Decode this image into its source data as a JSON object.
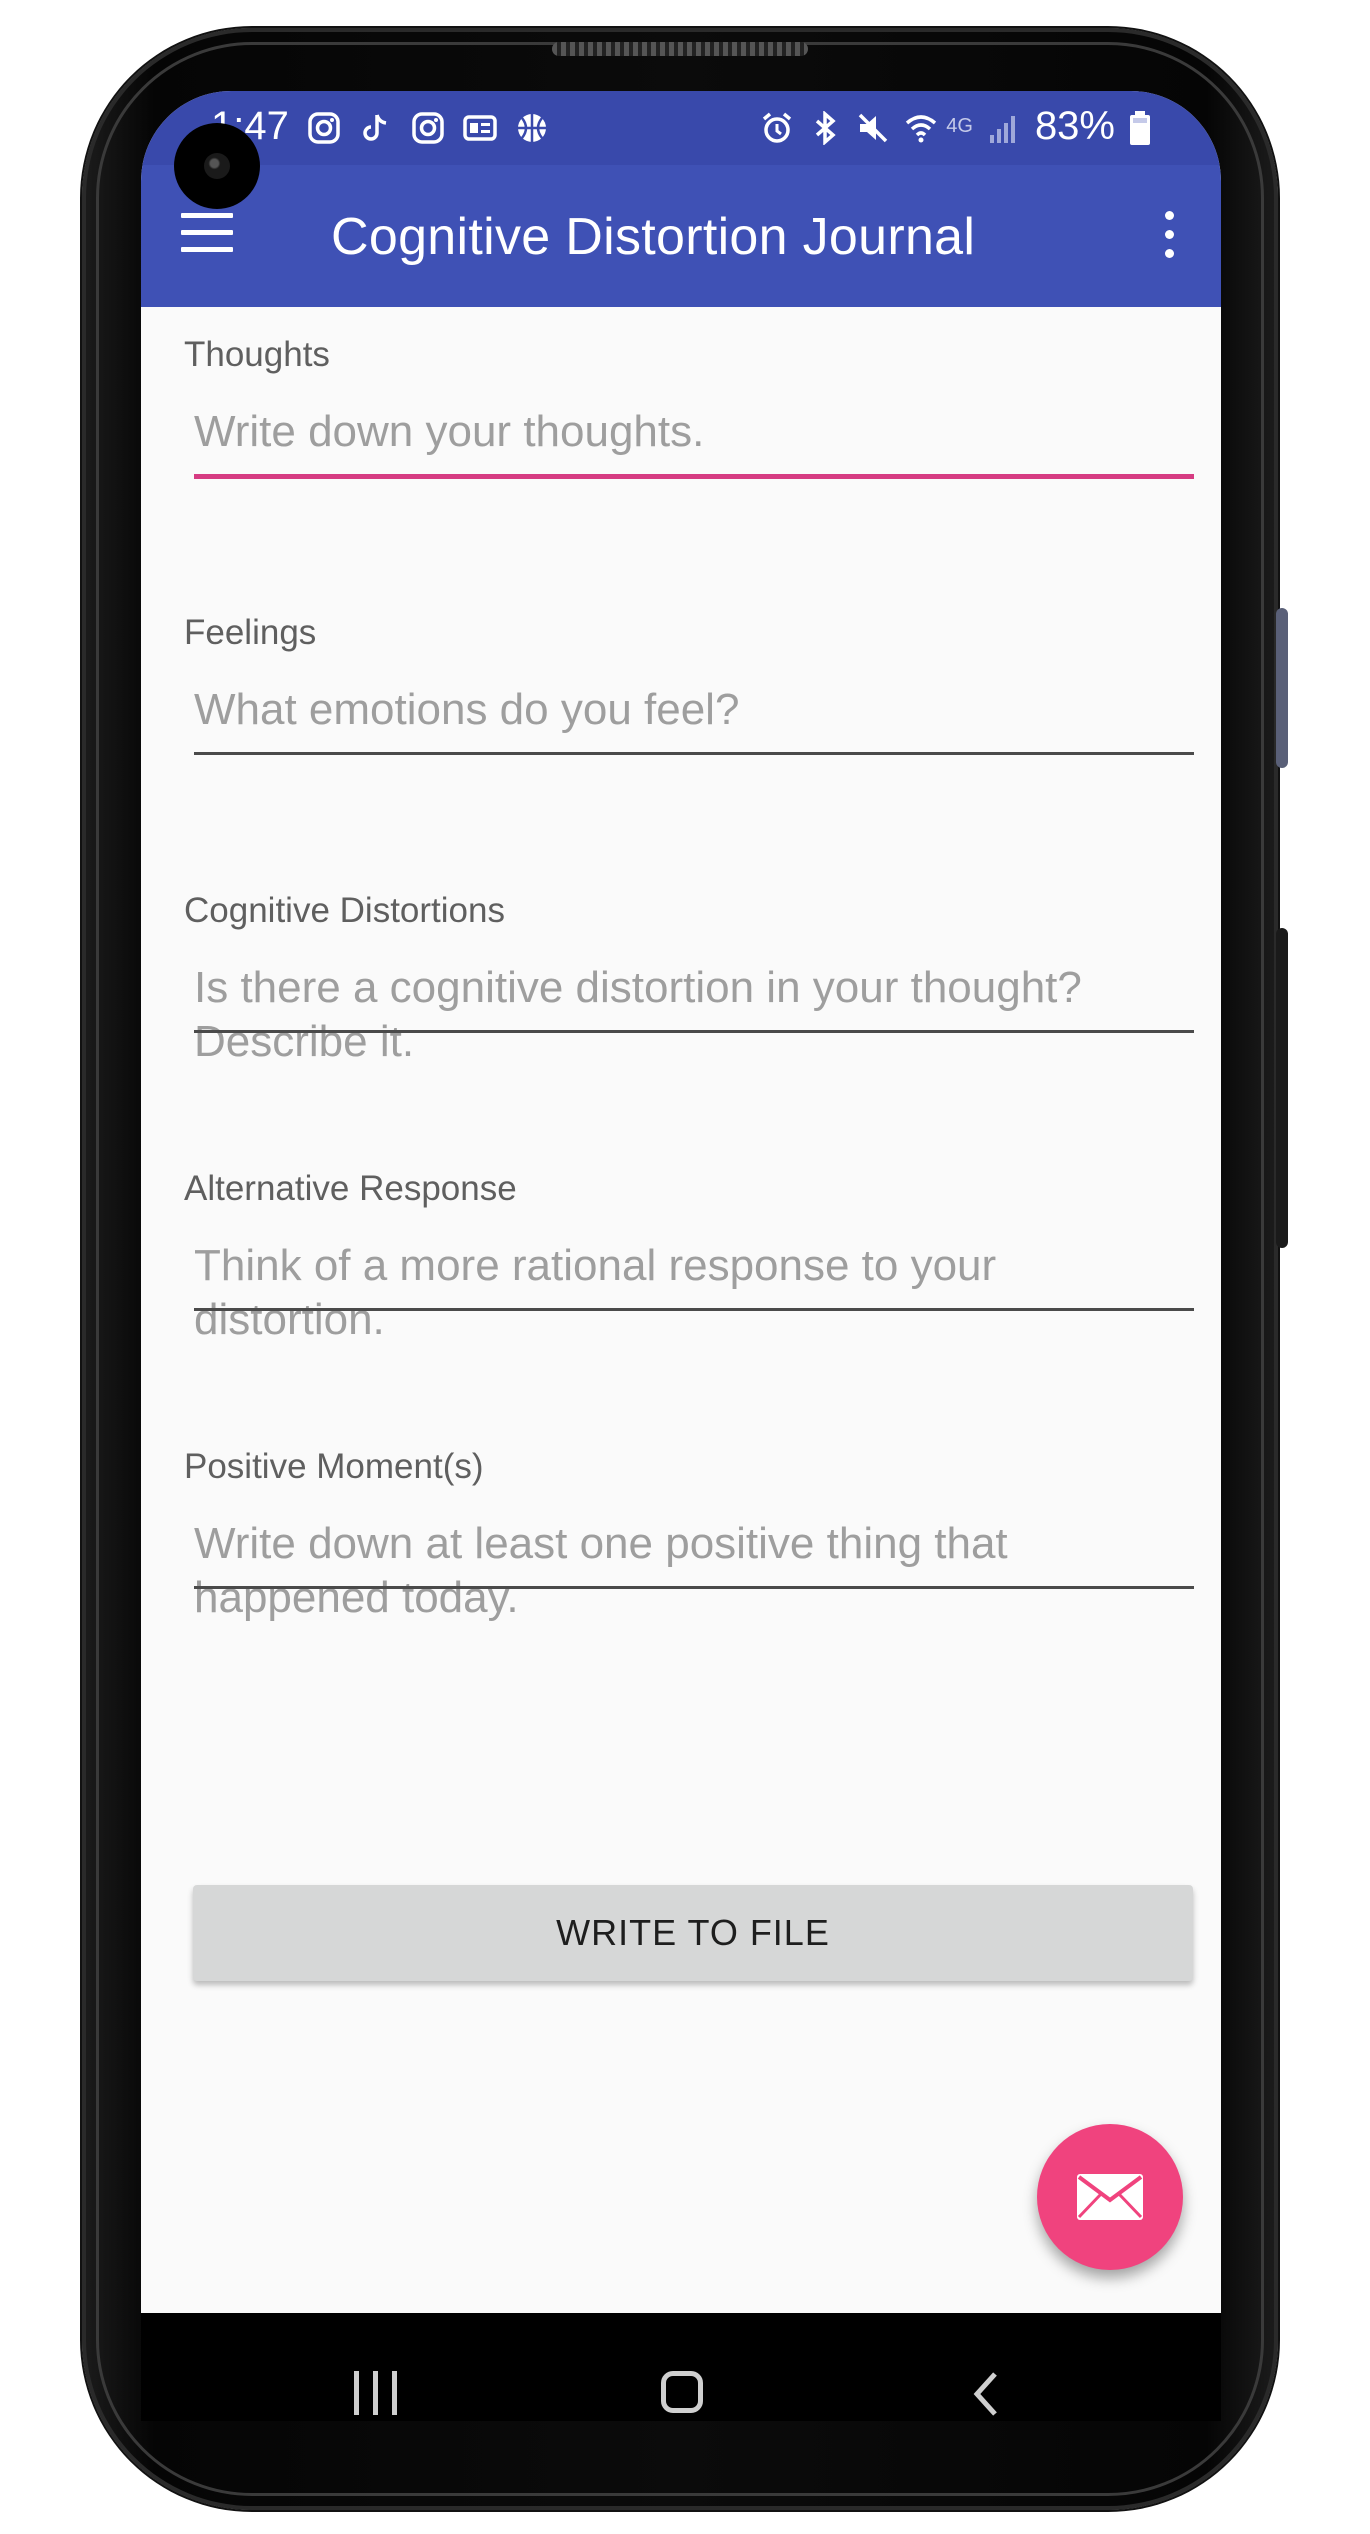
{
  "status_bar": {
    "time": "1:47",
    "notification_icons": [
      "instagram-icon",
      "tiktok-icon",
      "instagram-icon",
      "news-icon",
      "basketball-icon"
    ],
    "system_icons": [
      "alarm-icon",
      "bluetooth-icon",
      "mute-icon",
      "wifi-icon",
      "signal-icon"
    ],
    "network_label": "4G",
    "battery_percent": "83%"
  },
  "app_bar": {
    "title": "Cognitive Distortion Journal",
    "menu_icon": "hamburger-menu-icon",
    "overflow_icon": "more-vert-icon"
  },
  "form": {
    "fields": [
      {
        "label": "Thoughts",
        "placeholder": "Write down your thoughts.",
        "focused": true
      },
      {
        "label": "Feelings",
        "placeholder": "What emotions do you feel?",
        "focused": false
      },
      {
        "label": "Cognitive Distortions",
        "placeholder": "Is there a cognitive distortion in your thought? Describe it.",
        "focused": false
      },
      {
        "label": "Alternative Response",
        "placeholder": "Think of a more rational response to your distortion.",
        "focused": false
      },
      {
        "label": "Positive Moment(s)",
        "placeholder": "Write down at least one positive thing that happened today.",
        "focused": false
      }
    ],
    "submit_label": "WRITE TO FILE"
  },
  "fab": {
    "icon": "email-icon"
  },
  "colors": {
    "primary": "#3f51b5",
    "primary_dark": "#3949ab",
    "accent": "#f0437e",
    "focus_underline": "#d63c82",
    "background": "#fafafa",
    "button_gray": "#d6d7d7"
  },
  "nav_bar": {
    "buttons": [
      "recents-icon",
      "home-icon",
      "back-icon"
    ]
  }
}
